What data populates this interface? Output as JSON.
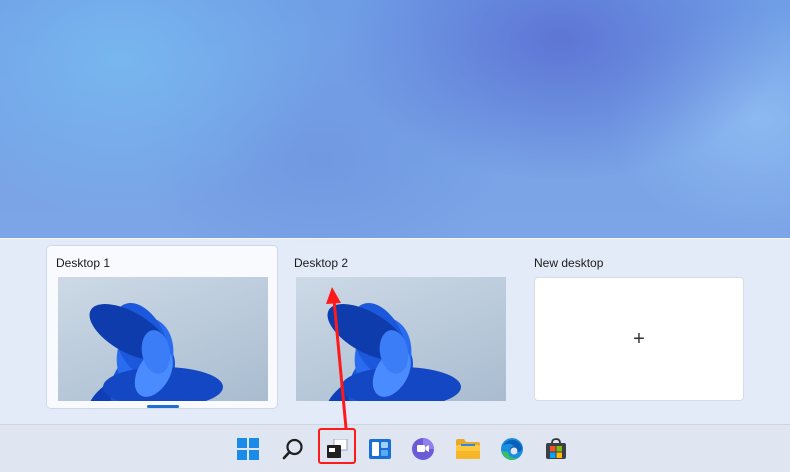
{
  "task_view": {
    "desktops": [
      {
        "label": "Desktop 1",
        "active": true
      },
      {
        "label": "Desktop 2",
        "active": false
      }
    ],
    "new_desktop": {
      "label": "New desktop",
      "plus": "+"
    }
  },
  "taskbar": {
    "icons": [
      "windows-start-icon",
      "search-icon",
      "task-view-icon",
      "widgets-icon",
      "teams-chat-icon",
      "file-explorer-icon",
      "edge-browser-icon",
      "microsoft-store-icon"
    ],
    "highlighted": "task-view-icon"
  },
  "colors": {
    "accent": "#1f6fd1",
    "annotation": "#ff1a1a",
    "bloom": "#1e5fe0"
  }
}
